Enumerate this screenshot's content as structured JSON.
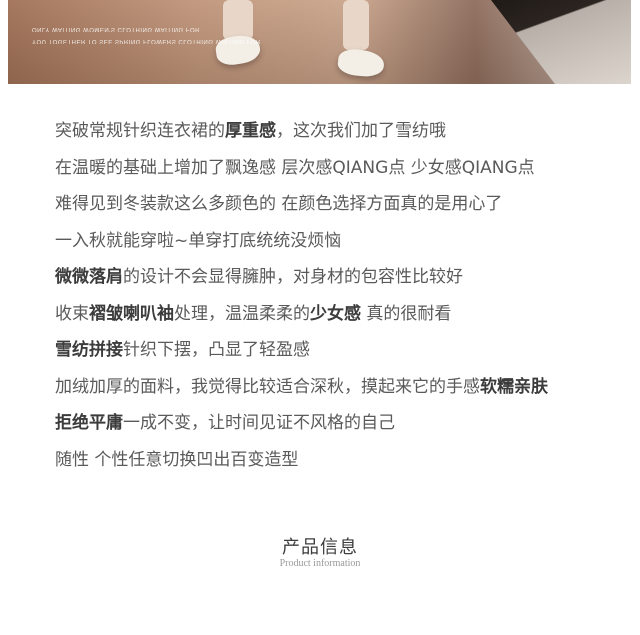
{
  "photo": {
    "caption_line1": "ONLY WAITING WOMEN'S CLOTHING WAITING FOR",
    "caption_line2": "YOU TOGETHER TO SEE SPRING FLOWERS CLOTHING WAITING FOR"
  },
  "description": [
    [
      {
        "t": "突破常规针织连衣裙的"
      },
      {
        "t": "厚重感",
        "b": true
      },
      {
        "t": "，这次我们加了雪纺哦"
      }
    ],
    [
      {
        "t": "在温暖的基础上增加了飘逸感 层次感QIANG点 少女感QIANG点"
      }
    ],
    [
      {
        "t": "难得见到冬装款这么多颜色的 在颜色选择方面真的是用心了"
      }
    ],
    [
      {
        "t": "一入秋就能穿啦~单穿打底统统没烦恼"
      }
    ],
    [
      {
        "t": "微微落肩",
        "b": true
      },
      {
        "t": "的设计不会显得臃肿，对身材的包容性比较好"
      }
    ],
    [
      {
        "t": "收束"
      },
      {
        "t": "褶皱喇叭袖",
        "b": true
      },
      {
        "t": "处理，温温柔柔的"
      },
      {
        "t": "少女感",
        "b": true
      },
      {
        "t": " 真的很耐看"
      }
    ],
    [
      {
        "t": "雪纺拼接",
        "b": true
      },
      {
        "t": "针织下摆，凸显了轻盈感"
      }
    ],
    [
      {
        "t": "加绒加厚的面料，我觉得比较适合深秋，摸起来它的手感"
      },
      {
        "t": "软糯亲肤",
        "b": true
      }
    ],
    [
      {
        "t": "拒绝平庸",
        "b": true
      },
      {
        "t": "一成不变，让时间见证不风格的自己"
      }
    ],
    [
      {
        "t": "随性 个性任意切换凹出百变造型"
      }
    ]
  ],
  "section": {
    "title": "产品信息",
    "subtitle": "Product information"
  }
}
